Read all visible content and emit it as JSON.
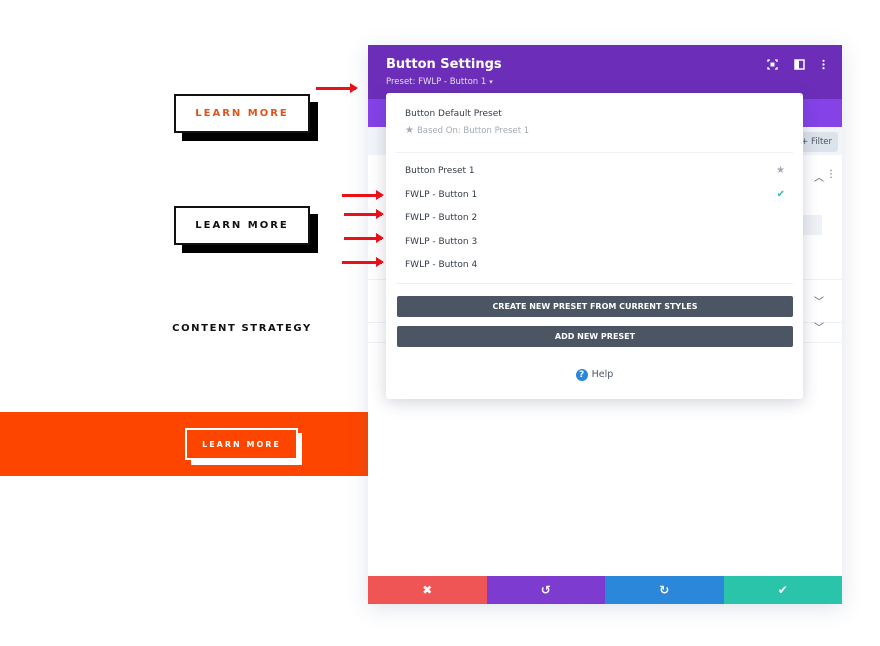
{
  "preview": {
    "button_top_label": "LEARN MORE",
    "button_middle_label": "LEARN MORE",
    "section_text": "CONTENT STRATEGY",
    "button_orange_label": "LEARN MORE",
    "colors": {
      "accent_orange": "#fe4500",
      "arrow_red": "#e8111a"
    }
  },
  "panel": {
    "title": "Button Settings",
    "preset_label": "Preset: FWLP - Button 1",
    "preset_caret": "▾",
    "header_icons": [
      "focus-icon",
      "split-view-icon",
      "more-options-icon"
    ],
    "filter_label": "+ Filter",
    "header_color": "#6c2eb9",
    "tabs_color": "#8542e7"
  },
  "dropdown": {
    "default_preset_title": "Button Default Preset",
    "based_on": "Based On: Button Preset 1",
    "items": [
      {
        "label": "Button Preset 1",
        "mark": "star"
      },
      {
        "label": "FWLP - Button 1",
        "mark": "check"
      },
      {
        "label": "FWLP - Button 2",
        "mark": ""
      },
      {
        "label": "FWLP - Button 3",
        "mark": ""
      },
      {
        "label": "FWLP - Button 4",
        "mark": ""
      }
    ],
    "create_button": "CREATE NEW PRESET FROM CURRENT STYLES",
    "add_button": "ADD NEW PRESET",
    "help_label": "Help"
  },
  "footer": {
    "buttons": [
      {
        "name": "discard",
        "glyph": "✖",
        "color": "#ef5555"
      },
      {
        "name": "undo",
        "glyph": "↺",
        "color": "#7e3bd0"
      },
      {
        "name": "redo",
        "glyph": "↻",
        "color": "#2b87da"
      },
      {
        "name": "save",
        "glyph": "✔",
        "color": "#29c4a9"
      }
    ]
  }
}
